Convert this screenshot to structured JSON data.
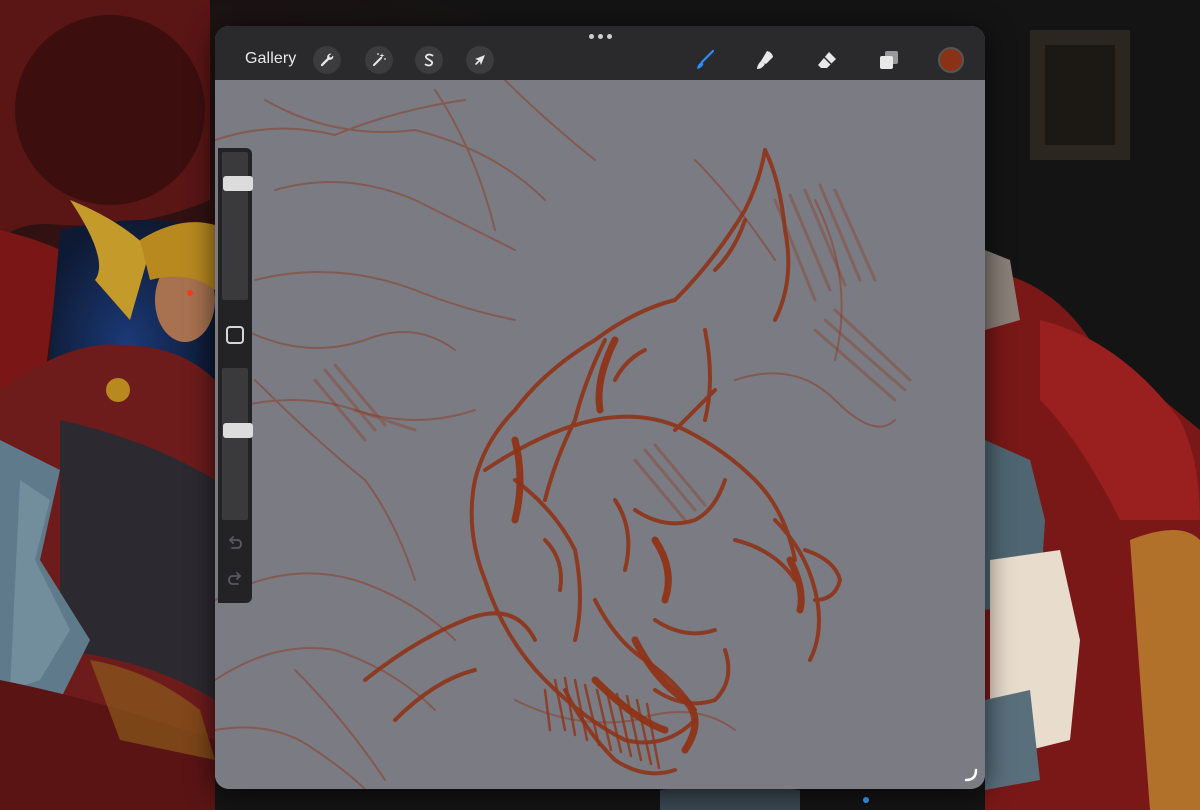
{
  "toolbar": {
    "gallery_label": "Gallery",
    "actions": [
      {
        "name": "actions",
        "icon": "wrench-icon"
      },
      {
        "name": "adjustments",
        "icon": "magic-wand-icon"
      },
      {
        "name": "selection",
        "icon": "selection-s-icon"
      },
      {
        "name": "transform",
        "icon": "arrow-cursor-icon"
      }
    ],
    "tools": [
      {
        "name": "brush",
        "icon": "brush-icon",
        "active": true
      },
      {
        "name": "smudge",
        "icon": "smudge-icon",
        "active": false
      },
      {
        "name": "eraser",
        "icon": "eraser-icon",
        "active": false
      },
      {
        "name": "layers",
        "icon": "layers-icon",
        "active": false
      }
    ],
    "current_color": "#8a3216"
  },
  "sidebar": {
    "brush_size_level": 0.82,
    "opacity_level": 0.6,
    "modify_icon": "square-icon",
    "undo_icon": "undo-icon",
    "redo_icon": "redo-icon"
  },
  "colors": {
    "accent": "#2f8cff",
    "toolbar_bg": "#2a2a2c",
    "canvas_bg": "#7b7b83",
    "stroke": "#8e3418"
  }
}
